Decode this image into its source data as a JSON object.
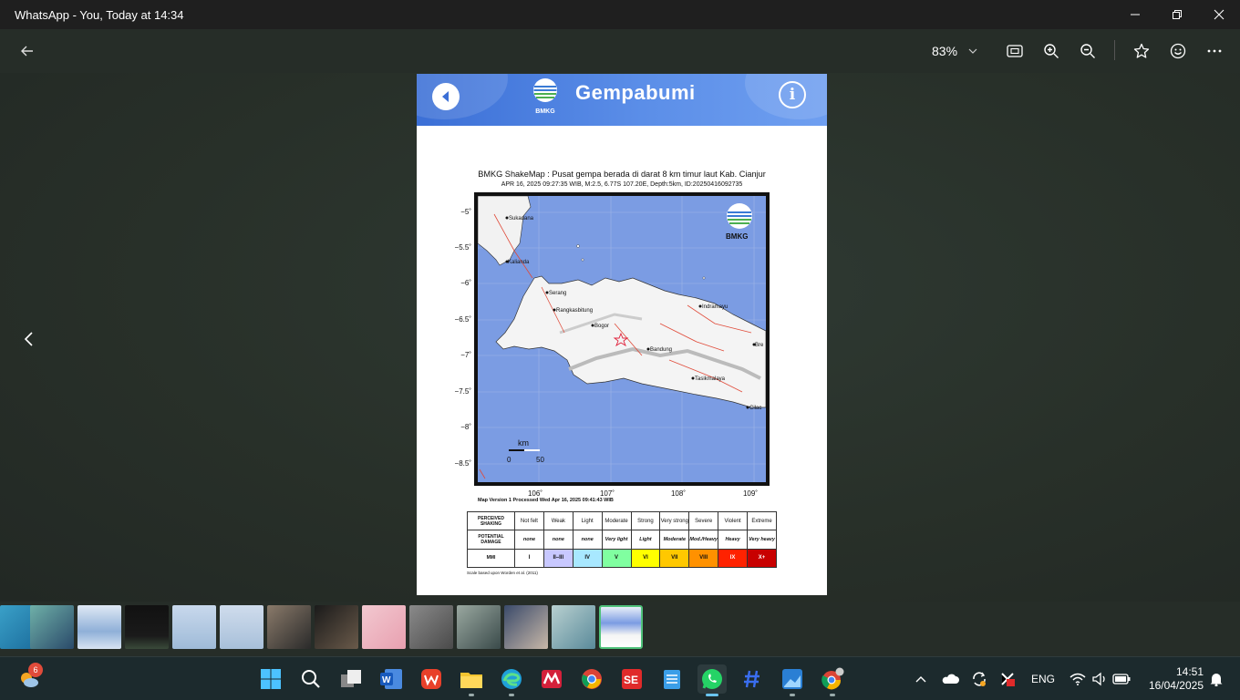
{
  "window": {
    "title": "WhatsApp - You, Today at 14:34"
  },
  "toolbar": {
    "zoom_level": "83%"
  },
  "document": {
    "header_title": "Gempabumi",
    "logo_text": "BMKG",
    "map_title": "BMKG ShakeMap : Pusat gempa berada di darat 8 km timur laut Kab. Cianjur",
    "map_subtitle": "APR 16, 2025 09:27:35 WIB, M:2.5, 6.77S 107.20E, Depth:5km, ID:20250416092735",
    "y_ticks": [
      "−5˚",
      "−5.5˚",
      "−6˚",
      "−6.5˚",
      "−7˚",
      "−7.5˚",
      "−8˚",
      "−8.5˚"
    ],
    "x_ticks": [
      "106˚",
      "107˚",
      "108˚",
      "109˚"
    ],
    "cities": [
      "Sukadana",
      "Kalianda",
      "Serang",
      "Rangkasbitung",
      "Bogor",
      "Indramayu",
      "Bandung",
      "Tasikmalaya",
      "Cilac",
      "Bre"
    ],
    "scale_bar": {
      "unit": "km",
      "start": "0",
      "end": "50"
    },
    "map_logo": "BMKG",
    "map_version": "Map Version 1 Processed Wed Apr 16, 2025 09:41:43 WIB",
    "intensity_table": {
      "row_labels": [
        "PERCEIVED SHAKING",
        "POTENTIAL DAMAGE",
        "MMI"
      ],
      "shaking": [
        "Not felt",
        "Weak",
        "Light",
        "Moderate",
        "Strong",
        "Very strong",
        "Severe",
        "Violent",
        "Extreme"
      ],
      "damage": [
        "none",
        "none",
        "none",
        "Very light",
        "Light",
        "Moderate",
        "Mod./Heavy",
        "Heavy",
        "Very heavy"
      ],
      "mmi": [
        "I",
        "II–III",
        "IV",
        "V",
        "VI",
        "VII",
        "VIII",
        "IX",
        "X+"
      ],
      "colors": [
        "#ffffff",
        "#c8c8ff",
        "#a8e8ff",
        "#80ffa0",
        "#ffff00",
        "#ffc800",
        "#ff9100",
        "#ff2200",
        "#c80000"
      ]
    },
    "scale_note": "Scale based upon Worden et al. (2011)"
  },
  "taskbar": {
    "weather_badge": "6",
    "language": "ENG",
    "time": "14:51",
    "date": "16/04/2025"
  }
}
